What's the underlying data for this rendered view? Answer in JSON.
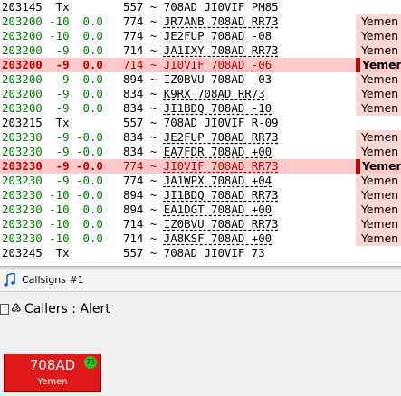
{
  "log": {
    "rows": [
      {
        "kind": "tx",
        "time": "203145",
        "db": "",
        "dt": "",
        "rest": "Tx",
        "freq": "557",
        "msg": "708AD JI0VIF PM85",
        "country": ""
      },
      {
        "kind": "rx",
        "time": "203200",
        "db": "-10",
        "dt": "0.0",
        "freq": "774",
        "msg": "JR7ANB 708AD RR73",
        "country": "Yemen"
      },
      {
        "kind": "rx",
        "time": "203200",
        "db": "-10",
        "dt": "0.0",
        "freq": "774",
        "msg": "JE2FUP 708AD -08",
        "country": "Yemen"
      },
      {
        "kind": "rx",
        "time": "203200",
        "db": "-9",
        "dt": "0.0",
        "freq": "714",
        "msg": "JA1IXY 708AD RR73",
        "country": "Yemen"
      },
      {
        "kind": "alert",
        "time": "203200",
        "db": "-9",
        "dt": "0.0",
        "freq": "714",
        "msg": "JI0VIF 708AD -06",
        "country": "Yemen"
      },
      {
        "kind": "rx",
        "time": "203200",
        "db": "-9",
        "dt": "0.0",
        "freq": "894",
        "msg": "IZ0BVU 708AD -03",
        "country": "Yemen"
      },
      {
        "kind": "rx",
        "time": "203200",
        "db": "-9",
        "dt": "0.0",
        "freq": "834",
        "msg": "K9RX 708AD RR73",
        "country": "Yemen"
      },
      {
        "kind": "rx",
        "time": "203200",
        "db": "-9",
        "dt": "0.0",
        "freq": "834",
        "msg": "JI1BDQ 708AD -10",
        "country": "Yemen"
      },
      {
        "kind": "tx",
        "time": "203215",
        "db": "",
        "dt": "",
        "rest": "Tx",
        "freq": "557",
        "msg": "708AD JI0VIF R-09",
        "country": ""
      },
      {
        "kind": "rx",
        "time": "203230",
        "db": "-9",
        "dt": "-0.0",
        "freq": "834",
        "msg": "JE2FUP 708AD RR73",
        "country": "Yemen"
      },
      {
        "kind": "rx",
        "time": "203230",
        "db": "-9",
        "dt": "-0.0",
        "freq": "834",
        "msg": "EA7FDR 708AD +00",
        "country": "Yemen"
      },
      {
        "kind": "alert",
        "time": "203230",
        "db": "-9",
        "dt": "-0.0",
        "freq": "774",
        "msg": "JI0VIF 708AD RR73",
        "country": "Yemen"
      },
      {
        "kind": "rx",
        "time": "203230",
        "db": "-9",
        "dt": "-0.0",
        "freq": "774",
        "msg": "JA1WPX 708AD +04",
        "country": "Yemen"
      },
      {
        "kind": "rx",
        "time": "203230",
        "db": "-10",
        "dt": "-0.0",
        "freq": "894",
        "msg": "JI1BDQ 708AD RR73",
        "country": "Yemen"
      },
      {
        "kind": "rx",
        "time": "203230",
        "db": "-10",
        "dt": "0.0",
        "freq": "894",
        "msg": "EA1DGT 708AD +00",
        "country": "Yemen"
      },
      {
        "kind": "rx",
        "time": "203230",
        "db": "-10",
        "dt": "0.0",
        "freq": "714",
        "msg": "IZ0BVU 708AD RR73",
        "country": "Yemen"
      },
      {
        "kind": "rx",
        "time": "203230",
        "db": "-10",
        "dt": "0.0",
        "freq": "714",
        "msg": "JA8KSF 708AD +00",
        "country": "Yemen"
      },
      {
        "kind": "tx",
        "time": "203245",
        "db": "",
        "dt": "",
        "rest": "Tx",
        "freq": "557",
        "msg": "708AD JI0VIF 73",
        "country": ""
      }
    ]
  },
  "callsigns_tab": {
    "label": "Callsigns #1",
    "icon": "music-note-icon"
  },
  "panel": {
    "title": "Callers : Alert",
    "pin_glyph": "♵"
  },
  "tile": {
    "call": "708AD",
    "country": "Yemen",
    "badge": "73",
    "color": "#e01a1a"
  }
}
